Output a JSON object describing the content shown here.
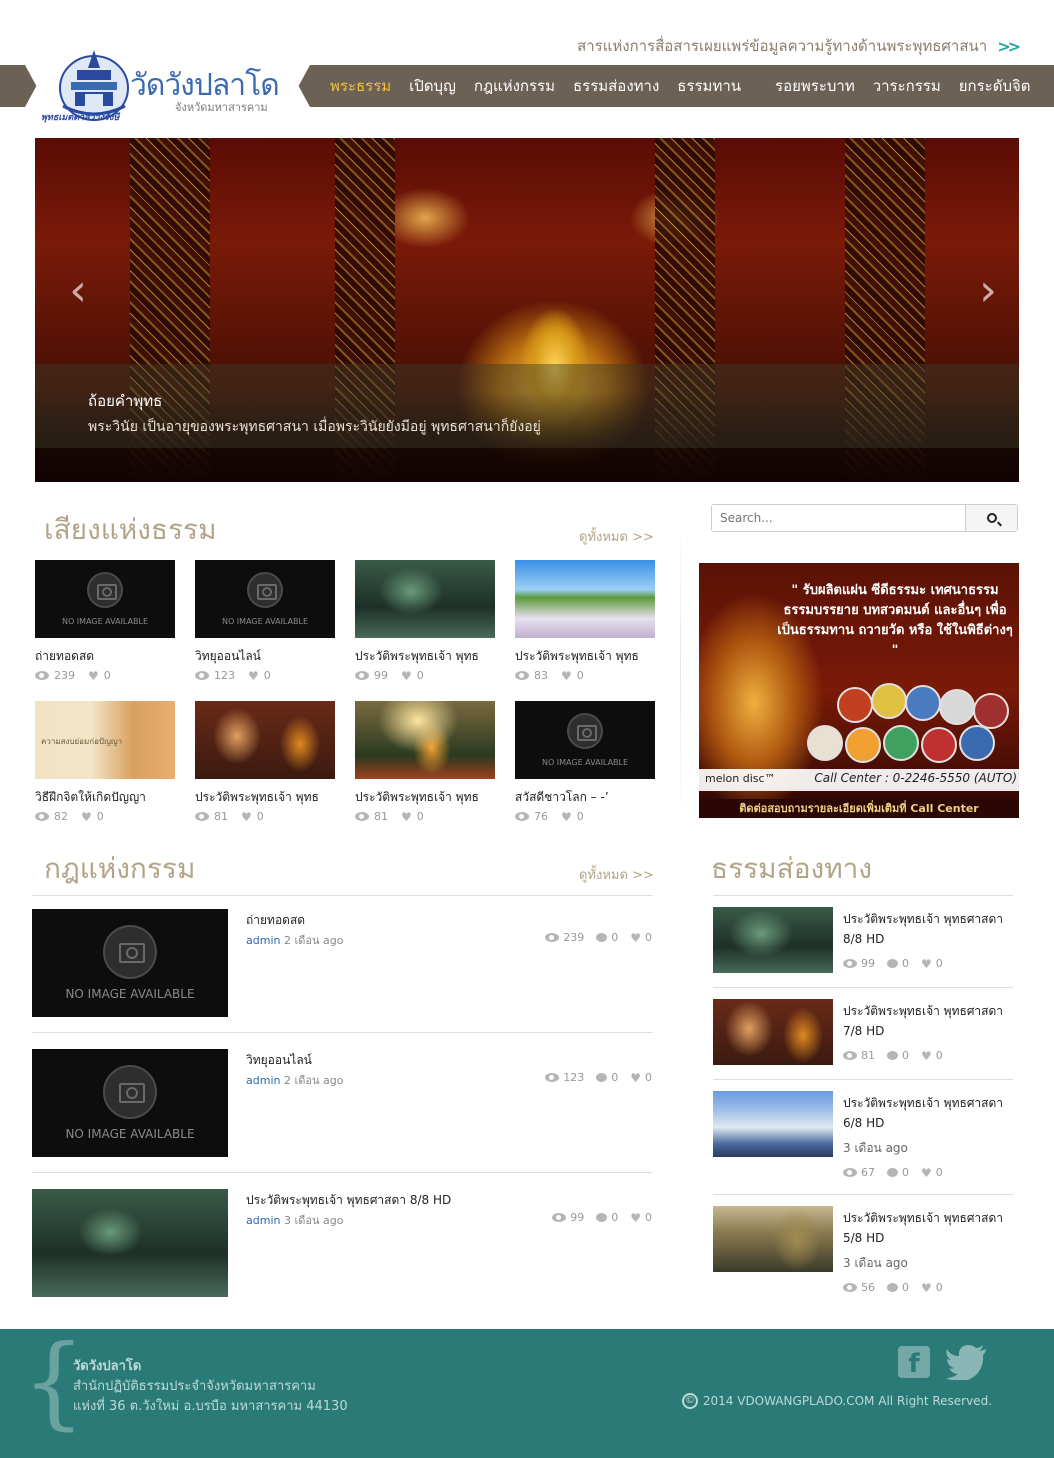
{
  "header": {
    "tagline": "สารแห่งการสื่อสารเผยแพร่ข้อมูลความรู้ทางด้านพระพุทธศาสนา",
    "tagline_arrow": ">>",
    "logo_title": "วัดวังปลาโด",
    "logo_subtitle": "จังหวัดมหาสารคาม",
    "logo_motto": "พุทธเมตตาสว่างรังษี",
    "nav": [
      {
        "label": "พระธรรม",
        "active": true
      },
      {
        "label": "เปิดบุญ"
      },
      {
        "label": "กฎแห่งกรรม"
      },
      {
        "label": "ธรรมส่องทาง"
      },
      {
        "label": "ธรรมทาน"
      },
      {
        "label": "รอยพระบาท"
      },
      {
        "label": "วาระกรรม"
      },
      {
        "label": "ยกระดับจิต"
      }
    ]
  },
  "hero": {
    "caption_title": "ถ้อยคำพุทธ",
    "caption_text": "พระวินัย เป็นอายุของพระพุทธศาสนา เมื่อพระวินัยยังมีอยู่ พุทธศาสนาก็ยังอยู่",
    "prev_label": "‹",
    "next_label": "›"
  },
  "sound_section": {
    "title": "เสียงแห่งธรรม",
    "see_all": "ดูทั้งหมด >>",
    "no_image_text": "NO IMAGE AVAILABLE",
    "items": [
      {
        "title": "ถ่ายทอดสด",
        "views": "239",
        "likes": "0",
        "thumb": "noimg"
      },
      {
        "title": "วิทยุออนไลน์",
        "views": "123",
        "likes": "0",
        "thumb": "noimg"
      },
      {
        "title": "ประวัติพระพุทธเจ้า พุทธ",
        "views": "99",
        "likes": "0",
        "thumb": "faces"
      },
      {
        "title": "ประวัติพระพุทธเจ้า พุทธ",
        "views": "83",
        "likes": "0",
        "thumb": "field"
      },
      {
        "title": "วิธีฝึกจิตให้เกิดปัญญา",
        "views": "82",
        "likes": "0",
        "thumb": "monk",
        "thumb_caption": "ความสงบย่อมก่อปัญญา"
      },
      {
        "title": "ประวัติพระพุทธเจ้า พุทธ",
        "views": "81",
        "likes": "0",
        "thumb": "warrior"
      },
      {
        "title": "ประวัติพระพุทธเจ้า พุทธ",
        "views": "81",
        "likes": "0",
        "thumb": "buddha-sun"
      },
      {
        "title": "สวัสดีชาวโลก – -’",
        "views": "76",
        "likes": "0",
        "thumb": "noimg"
      }
    ]
  },
  "karma_section": {
    "title": "กฎแห่งกรรม",
    "see_all": "ดูทั้งหมด >>",
    "rows": [
      {
        "title": "ถ่ายทอดสด",
        "author": "admin",
        "time": "2 เดือน ago",
        "views": "239",
        "comments": "0",
        "likes": "0",
        "thumb": "noimg"
      },
      {
        "title": "วิทยุออนไลน์",
        "author": "admin",
        "time": "2 เดือน ago",
        "views": "123",
        "comments": "0",
        "likes": "0",
        "thumb": "noimg"
      },
      {
        "title": "ประวัติพระพุทธเจ้า พุทธศาสดา 8/8 HD",
        "author": "admin",
        "time": "3 เดือน ago",
        "views": "99",
        "comments": "0",
        "likes": "0",
        "thumb": "faces"
      }
    ]
  },
  "sidebar": {
    "search_placeholder": "Search...",
    "ad": {
      "text": "\" รับผลิตแผ่น ซีดีธรรมะ เทศนาธรรม ธรรมบรรยาย บทสวดมนต์ และอื่นๆ เพื่อเป็นธรรมทาน ถวายวัด หรือ ใช้ในพิธีต่างๆ \"",
      "brand": "melon disc™",
      "phone": "Call Center : 0-2246-5550 (AUTO)",
      "footer": "ติดต่อสอบถามรายละเอียดเพิ่มเติมที่ Call Center"
    },
    "guide_title": "ธรรมส่องทาง",
    "guide_items": [
      {
        "title": "ประวัติพระพุทธเจ้า พุทธศาสดา 8/8 HD",
        "date": "",
        "views": "99",
        "comments": "0",
        "likes": "0",
        "thumb": "faces"
      },
      {
        "title": "ประวัติพระพุทธเจ้า พุทธศาสดา 7/8 HD",
        "date": "",
        "views": "81",
        "comments": "0",
        "likes": "0",
        "thumb": "warrior"
      },
      {
        "title": "ประวัติพระพุทธเจ้า พุทธศาสดา 6/8 HD",
        "date": "3 เดือน ago",
        "views": "67",
        "comments": "0",
        "likes": "0",
        "thumb": "crowd-blue"
      },
      {
        "title": "ประวัติพระพุทธเจ้า พุทธศาสดา 5/8 HD",
        "date": "3 เดือน ago",
        "views": "56",
        "comments": "0",
        "likes": "0",
        "thumb": "temple"
      }
    ]
  },
  "footer": {
    "name": "วัดวังปลาโด",
    "desc": "สำนักปฏิบัติธรรมประจำจังหวัดมหาสารคาม",
    "address": "แห่งที่ 36 ต.วังใหม่ อ.บรบือ มหาสารคาม 44130",
    "copyright": "2014 VDOWANGPLADO.COM All Right Reserved.",
    "facebook_icon": "f",
    "colors": {
      "footer_bg": "#2a7a78",
      "nav_bg": "#6b6155",
      "accent": "#22a6a0",
      "active_nav": "#f2c23a"
    }
  }
}
